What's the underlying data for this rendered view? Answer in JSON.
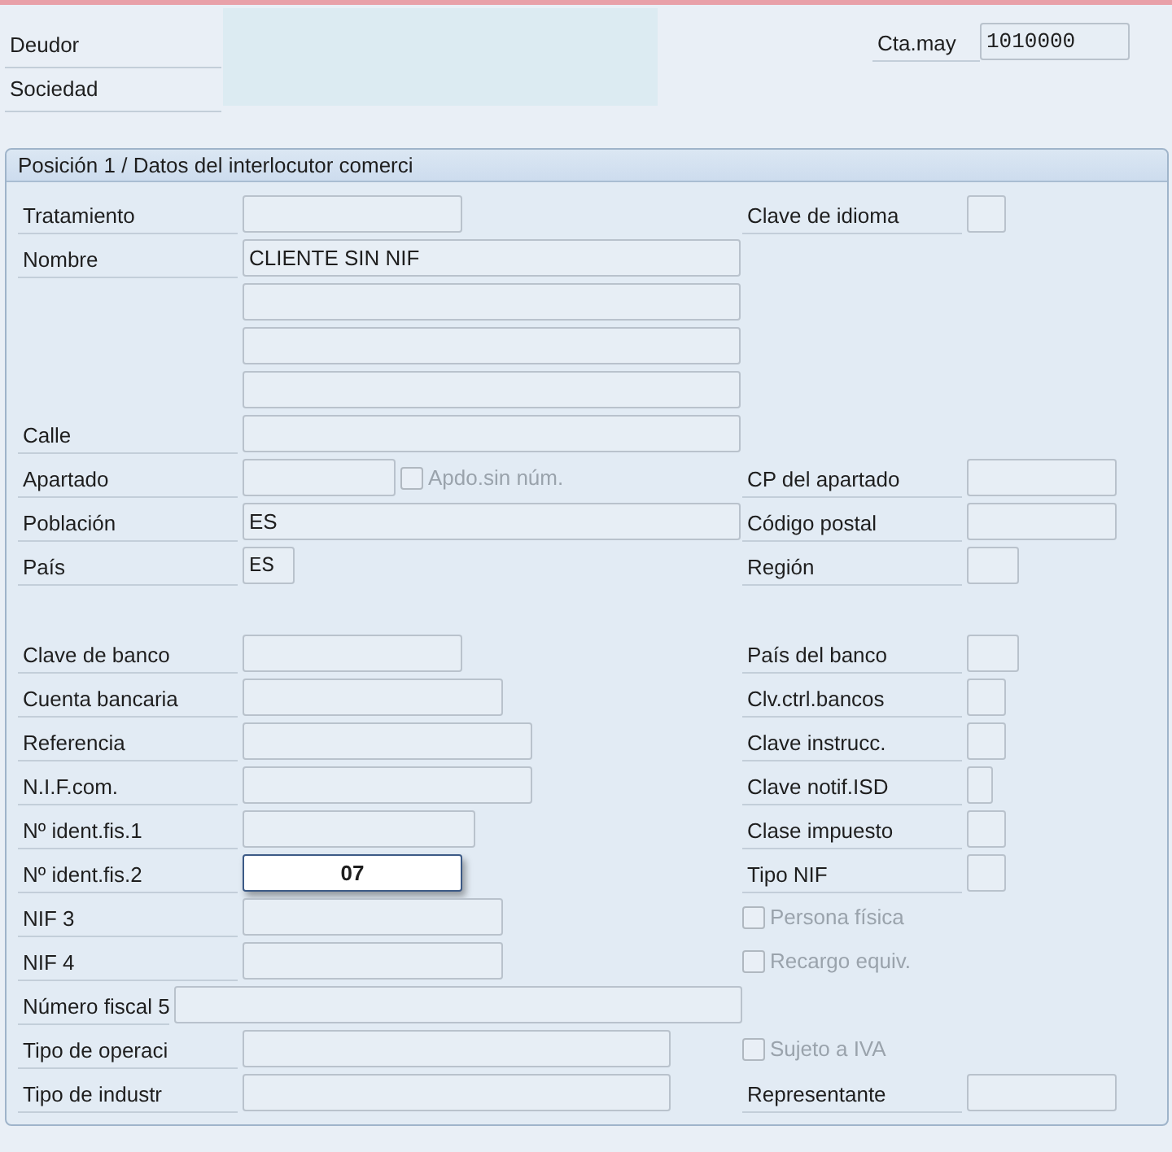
{
  "header": {
    "fields": [
      {
        "label": "Deudor"
      },
      {
        "label": "Sociedad"
      }
    ],
    "account": {
      "label": "Cta.may",
      "value": "1010000"
    }
  },
  "section": {
    "title": "Posición 1 / Datos del interlocutor comerci",
    "groups": [
      {
        "rows": [
          {
            "left": {
              "kind": "field",
              "label": "Tratamiento"
            },
            "right": {
              "kind": "field",
              "label": "Clave de idioma"
            }
          },
          {
            "left": {
              "kind": "field",
              "label": "Nombre",
              "value": "CLIENTE SIN NIF"
            }
          },
          {
            "left": {
              "kind": "field"
            }
          },
          {
            "left": {
              "kind": "field"
            }
          },
          {
            "left": {
              "kind": "field"
            }
          },
          {
            "left": {
              "kind": "field",
              "label": "Calle"
            }
          },
          {
            "left": {
              "kind": "field",
              "label": "Apartado",
              "checkbox": {
                "label": "Apdo.sin núm.",
                "checked": false,
                "disabled": true
              }
            },
            "right": {
              "kind": "field",
              "label": "CP del apartado"
            }
          },
          {
            "left": {
              "kind": "field",
              "label": "Población",
              "value": "ES"
            },
            "right": {
              "kind": "field",
              "label": "Código postal"
            }
          },
          {
            "left": {
              "kind": "field",
              "label": "País",
              "value": "ES"
            },
            "right": {
              "kind": "field",
              "label": "Región"
            }
          }
        ]
      },
      {
        "rows": [
          {
            "left": {
              "kind": "field",
              "label": "Clave de banco"
            },
            "right": {
              "kind": "field",
              "label": "País del banco"
            }
          },
          {
            "left": {
              "kind": "field",
              "label": "Cuenta bancaria"
            },
            "right": {
              "kind": "field",
              "label": "Clv.ctrl.bancos"
            }
          },
          {
            "left": {
              "kind": "field",
              "label": "Referencia"
            },
            "right": {
              "kind": "field",
              "label": "Clave instrucc."
            }
          },
          {
            "left": {
              "kind": "field",
              "label": "N.I.F.com."
            },
            "right": {
              "kind": "field",
              "label": "Clave notif.ISD"
            }
          },
          {
            "left": {
              "kind": "field",
              "label": "Nº ident.fis.1"
            },
            "right": {
              "kind": "field",
              "label": "Clase impuesto"
            }
          },
          {
            "left": {
              "kind": "field",
              "label": "Nº ident.fis.2",
              "value": "07",
              "focused": true
            },
            "right": {
              "kind": "field",
              "label": "Tipo NIF"
            }
          },
          {
            "left": {
              "kind": "field",
              "label": "NIF 3"
            },
            "right": {
              "kind": "checkbox",
              "label": "Persona física",
              "checked": false,
              "disabled": true
            }
          },
          {
            "left": {
              "kind": "field",
              "label": "NIF 4"
            },
            "right": {
              "kind": "checkbox",
              "label": "Recargo equiv.",
              "checked": false,
              "disabled": true
            }
          },
          {
            "left": {
              "kind": "field",
              "label": "Número fiscal 5"
            }
          },
          {
            "left": {
              "kind": "field",
              "label": "Tipo de operaci"
            },
            "right": {
              "kind": "checkbox",
              "label": "Sujeto a IVA",
              "checked": false,
              "disabled": true
            }
          },
          {
            "left": {
              "kind": "field",
              "label": "Tipo de industr"
            },
            "right": {
              "kind": "field",
              "label": "Representante"
            }
          }
        ]
      }
    ]
  }
}
